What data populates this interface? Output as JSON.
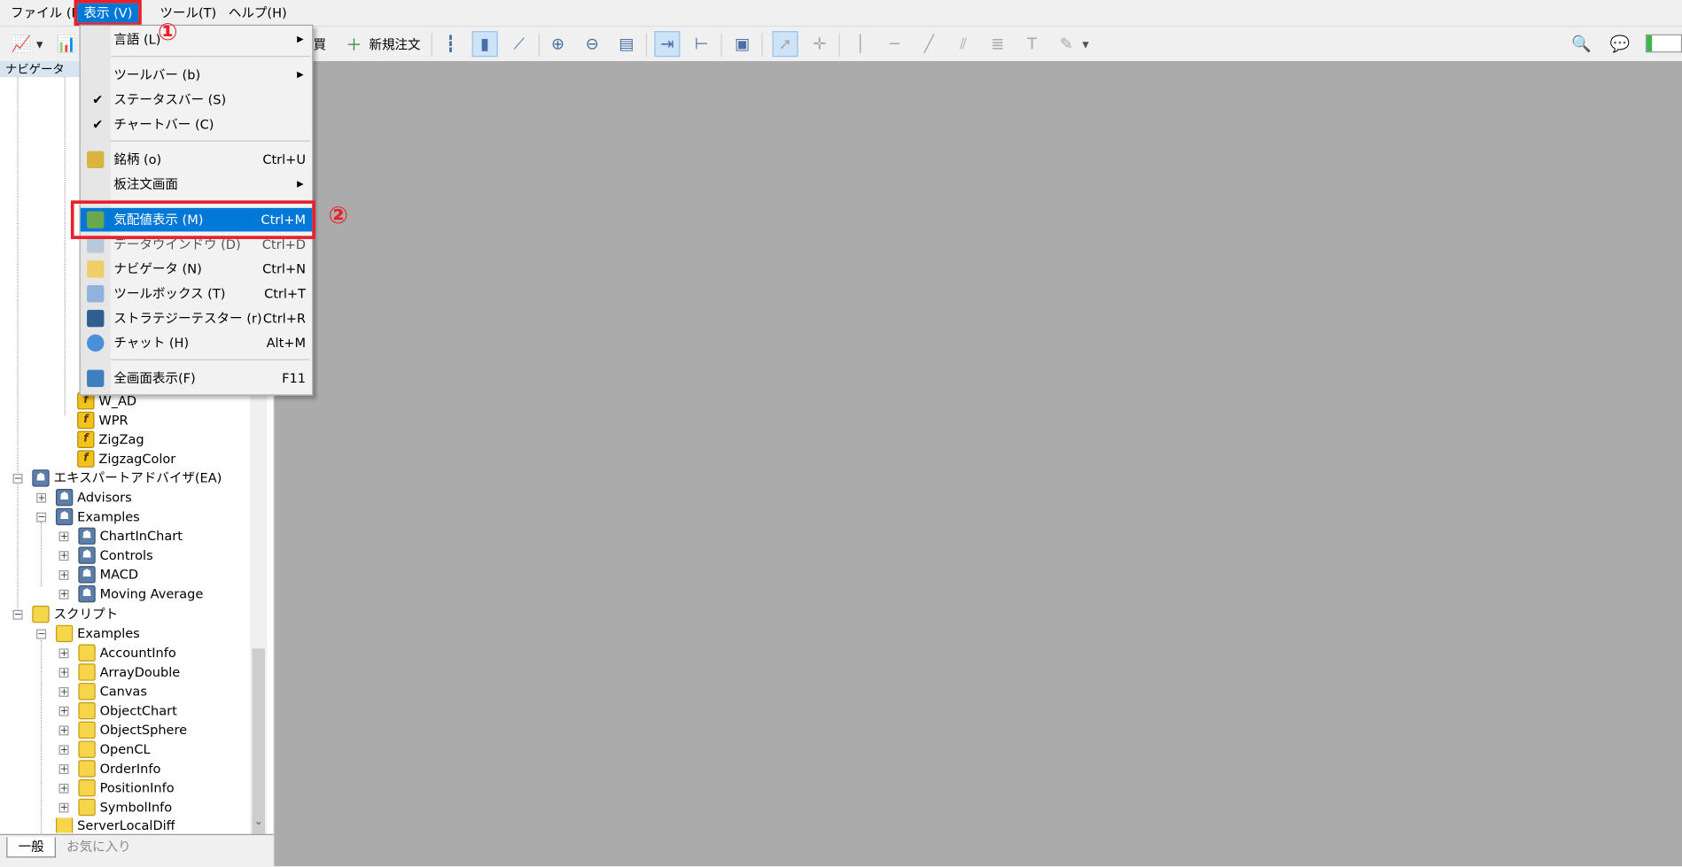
{
  "menubar": {
    "items": [
      "ファイル (F)",
      "表示 (V)",
      "ツール(T)",
      "ヘルプ(H)"
    ]
  },
  "toolbar": {
    "buy_label": "買",
    "new_order_label": "新規注文"
  },
  "navigator": {
    "title": "ナビゲータ",
    "indicators": [
      "W_AD",
      "WPR",
      "ZigZag",
      "ZigzagColor"
    ],
    "ea_root": "エキスパートアドバイザ(EA)",
    "ea_advisors": "Advisors",
    "ea_examples": "Examples",
    "ea_example_items": [
      "ChartInChart",
      "Controls",
      "MACD",
      "Moving Average"
    ],
    "scripts_root": "スクリプト",
    "scripts_examples": "Examples",
    "script_items": [
      "AccountInfo",
      "ArrayDouble",
      "Canvas",
      "ObjectChart",
      "ObjectSphere",
      "OpenCL",
      "OrderInfo",
      "PositionInfo",
      "SymbolInfo"
    ],
    "script_last": "ServerLocalDiff",
    "tabs": [
      "一般",
      "お気に入り"
    ]
  },
  "view_menu": {
    "items": [
      {
        "label": "言語 (L)",
        "shortcut": "",
        "submenu": true
      },
      {
        "label": "ツールバー (b)",
        "shortcut": "",
        "submenu": true
      },
      {
        "label": "ステータスバー (S)",
        "shortcut": "",
        "checked": true
      },
      {
        "label": "チャートバー (C)",
        "shortcut": "",
        "checked": true
      },
      {
        "label": "銘柄 (o)",
        "shortcut": "Ctrl+U"
      },
      {
        "label": "板注文画面",
        "shortcut": "",
        "submenu": true
      },
      {
        "label": "気配値表示 (M)",
        "shortcut": "Ctrl+M",
        "highlighted": true
      },
      {
        "label": "データウインドウ (D)",
        "shortcut": "Ctrl+D"
      },
      {
        "label": "ナビゲータ (N)",
        "shortcut": "Ctrl+N"
      },
      {
        "label": "ツールボックス (T)",
        "shortcut": "Ctrl+T"
      },
      {
        "label": "ストラテジーテスター (r)",
        "shortcut": "Ctrl+R"
      },
      {
        "label": "チャット (H)",
        "shortcut": "Alt+M"
      },
      {
        "label": "全画面表示(F)",
        "shortcut": "F11"
      }
    ]
  },
  "annotations": {
    "step1": "①",
    "step2": "②"
  },
  "colors": {
    "highlight": "#0078d7",
    "annotation_red": "#e8202a",
    "workspace_bg": "#ababab"
  }
}
